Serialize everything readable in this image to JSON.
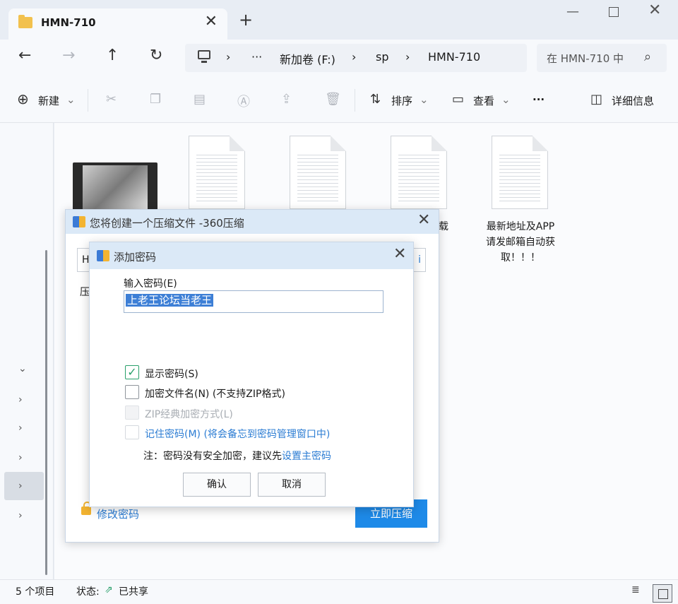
{
  "window": {
    "tab_title": "HMN-710",
    "tab_close": "✕",
    "new_tab": "+",
    "minimize": "—",
    "close": "✕"
  },
  "nav": {
    "back": "←",
    "forward": "→",
    "up": "↑",
    "refresh": "↻",
    "breadcrumb": [
      "›",
      "···",
      "新加卷 (F:)",
      "›",
      "sp",
      "›",
      "HMN-710"
    ],
    "search_placeholder": "在 HMN-710 中",
    "search_icon": "⌕"
  },
  "toolbar": {
    "new_label": "新建",
    "sort_label": "排序",
    "view_label": "查看",
    "more_label": "···",
    "details_label": "详细信息",
    "dropdown": "⌄",
    "icons": [
      "cut-icon",
      "copy-icon",
      "paste-icon",
      "rename-icon",
      "share-icon",
      "delete-icon"
    ]
  },
  "files": [
    {
      "name": "",
      "type": "video"
    },
    {
      "name": "",
      "type": "text"
    },
    {
      "name": "",
      "type": "text"
    },
    {
      "name": "下载\n免",
      "type": "text"
    },
    {
      "name": "最新地址及APP\n请发邮箱自动获\n取！！！",
      "type": "text"
    }
  ],
  "status": {
    "item_count": "5 个项目",
    "state_label": "状态:",
    "share_state": "已共享"
  },
  "compress_dialog": {
    "title": "您将创建一个压缩文件 -360压缩",
    "close": "✕",
    "path_lead": "H",
    "path_trail": "i",
    "label_compress": "压",
    "modify_password": "修改密码",
    "compress_now": "立即压缩"
  },
  "password_dialog": {
    "title": "添加密码",
    "close": "✕",
    "input_label": "输入密码(E)",
    "password_value": "上老王论坛当老王",
    "show_password": "显示密码(S)",
    "show_password_check": "✓",
    "encrypt_filenames": "加密文件名(N) (不支持ZIP格式)",
    "zip_classic": "ZIP经典加密方式(L)",
    "remember_password": "记住密码(M) (将会备忘到密码管理窗口中)",
    "note_prefix": "注：密码没有安全加密，建议先",
    "note_link": "设置主密码",
    "ok": "确认",
    "cancel": "取消"
  }
}
